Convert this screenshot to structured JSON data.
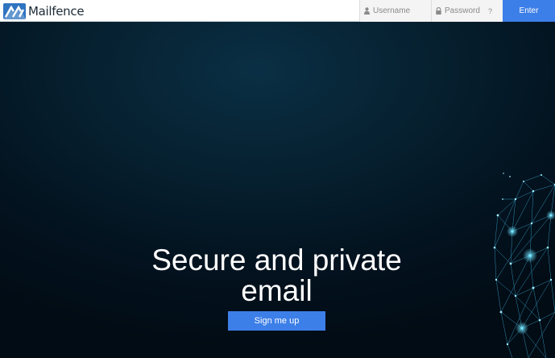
{
  "header": {
    "brand_name": "Mailfence",
    "username": {
      "placeholder": "Username",
      "value": ""
    },
    "password": {
      "placeholder": "Password",
      "value": ""
    },
    "help_label": "?",
    "enter_label": "Enter",
    "icons": {
      "logo": "mailfence-logo",
      "username": "person-icon",
      "password": "lock-icon"
    },
    "colors": {
      "accent": "#3d7fe8",
      "brand": "#2f74c0"
    }
  },
  "hero": {
    "headline": "Secure and private email",
    "cta_label": "Sign me up",
    "background_color": "#031320",
    "decoration": "network-mesh"
  }
}
